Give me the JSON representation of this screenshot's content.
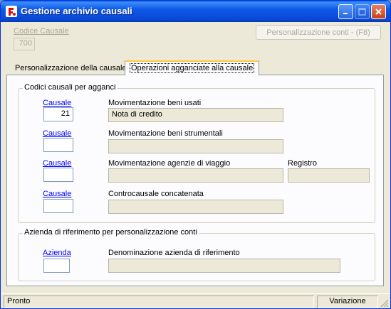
{
  "window": {
    "title": "Gestione archivio causali"
  },
  "header": {
    "codice_causale_label": "Codice Causale",
    "codice_causale_value": "700",
    "personalizzazione_button": "Personalizzazione conti - (F8)"
  },
  "tabs": [
    {
      "label": "Personalizzazione della causale",
      "active": false
    },
    {
      "label": "Operazioni agganciate alla causale",
      "active": true
    }
  ],
  "group_codici": {
    "title": "Codici causali per agganci",
    "rows": [
      {
        "link": "Causale",
        "code": "21",
        "desc_label": "Movimentazione beni usati",
        "desc_value": "Nota di credito"
      },
      {
        "link": "Causale",
        "code": "",
        "desc_label": "Movimentazione beni strumentali",
        "desc_value": ""
      },
      {
        "link": "Causale",
        "code": "",
        "desc_label": "Movimentazione agenzie di viaggio",
        "desc_value": ""
      },
      {
        "link": "Causale",
        "code": "",
        "desc_label": "Controcausale concatenata",
        "desc_value": ""
      }
    ],
    "registro_label": "Registro",
    "registro_value": ""
  },
  "group_azienda": {
    "title": "Azienda di riferimento per personalizzazione conti",
    "link": "Azienda",
    "code": "",
    "desc_label": "Denominazione azienda di riferimento",
    "desc_value": ""
  },
  "statusbar": {
    "left": "Pronto",
    "right": "Variazione"
  }
}
